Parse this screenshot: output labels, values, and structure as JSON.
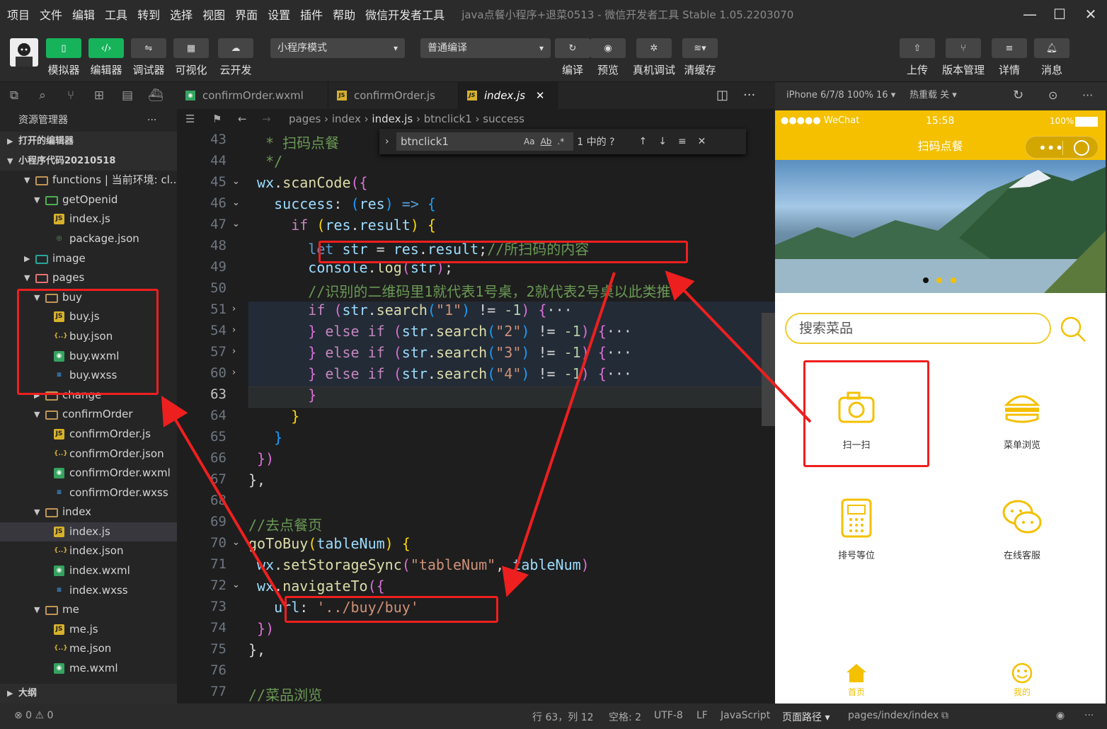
{
  "menu": [
    "项目",
    "文件",
    "编辑",
    "工具",
    "转到",
    "选择",
    "视图",
    "界面",
    "设置",
    "插件",
    "帮助",
    "微信开发者工具"
  ],
  "window_title": "java点餐小程序+退菜0513 - 微信开发者工具 Stable 1.05.2203070",
  "toolbar": {
    "simulator": "模拟器",
    "editor": "编辑器",
    "debugger": "调试器",
    "visual": "可视化",
    "cloud": "云开发",
    "mode": "小程序模式",
    "compile_mode": "普通编译",
    "compile": "编译",
    "preview": "预览",
    "real_debug": "真机调试",
    "clear_cache": "清缓存",
    "upload": "上传",
    "version": "版本管理",
    "details": "详情",
    "messages": "消息"
  },
  "explorer": {
    "title": "资源管理器",
    "more": "···",
    "open_editors": "打开的编辑器",
    "project": "小程序代码20210518",
    "outline": "大纲",
    "items": [
      {
        "label": "functions | 当前环境: cl...",
        "indent": 1,
        "type": "folder",
        "open": true
      },
      {
        "label": "getOpenid",
        "indent": 2,
        "type": "folder-green",
        "open": true
      },
      {
        "label": "index.js",
        "indent": 3,
        "type": "js"
      },
      {
        "label": "package.json",
        "indent": 3,
        "type": "pkg"
      },
      {
        "label": "image",
        "indent": 1,
        "type": "folder-img",
        "open": false
      },
      {
        "label": "pages",
        "indent": 1,
        "type": "folder-red",
        "open": true
      },
      {
        "label": "buy",
        "indent": 2,
        "type": "folder",
        "open": true
      },
      {
        "label": "buy.js",
        "indent": 3,
        "type": "js"
      },
      {
        "label": "buy.json",
        "indent": 3,
        "type": "json"
      },
      {
        "label": "buy.wxml",
        "indent": 3,
        "type": "wxml"
      },
      {
        "label": "buy.wxss",
        "indent": 3,
        "type": "wxss"
      },
      {
        "label": "change",
        "indent": 2,
        "type": "folder",
        "open": false
      },
      {
        "label": "confirmOrder",
        "indent": 2,
        "type": "folder",
        "open": true
      },
      {
        "label": "confirmOrder.js",
        "indent": 3,
        "type": "js"
      },
      {
        "label": "confirmOrder.json",
        "indent": 3,
        "type": "json"
      },
      {
        "label": "confirmOrder.wxml",
        "indent": 3,
        "type": "wxml"
      },
      {
        "label": "confirmOrder.wxss",
        "indent": 3,
        "type": "wxss"
      },
      {
        "label": "index",
        "indent": 2,
        "type": "folder",
        "open": true
      },
      {
        "label": "index.js",
        "indent": 3,
        "type": "js",
        "selected": true
      },
      {
        "label": "index.json",
        "indent": 3,
        "type": "json"
      },
      {
        "label": "index.wxml",
        "indent": 3,
        "type": "wxml"
      },
      {
        "label": "index.wxss",
        "indent": 3,
        "type": "wxss"
      },
      {
        "label": "me",
        "indent": 2,
        "type": "folder",
        "open": true
      },
      {
        "label": "me.js",
        "indent": 3,
        "type": "js"
      },
      {
        "label": "me.json",
        "indent": 3,
        "type": "json"
      },
      {
        "label": "me.wxml",
        "indent": 3,
        "type": "wxml"
      }
    ]
  },
  "tabs": [
    {
      "label": "confirmOrder.wxml",
      "icon": "wxml"
    },
    {
      "label": "confirmOrder.js",
      "icon": "js"
    },
    {
      "label": "index.js",
      "icon": "js",
      "active": true
    }
  ],
  "breadcrumb": [
    "pages",
    "index",
    "index.js",
    "btnclick1",
    "success"
  ],
  "find": {
    "query": "btnclick1",
    "result": "1 中的 ?"
  },
  "code": [
    {
      "n": "43",
      "html": "  <span class='c'>* 扫码点餐</span>"
    },
    {
      "n": "44",
      "html": "  <span class='c'>*/</span>"
    },
    {
      "n": "45",
      "html": " <span class='v'>wx</span>.<span class='f'>scanCode</span><span class='p'>({</span>",
      "fold": "v"
    },
    {
      "n": "46",
      "html": "   <span class='v'>success</span>: <span class='bl'>(</span><span class='v'>res</span><span class='bl'>)</span> <span class='b'>=&gt;</span> <span class='bl'>{</span>",
      "fold": "v"
    },
    {
      "n": "47",
      "html": "     <span class='k'>if</span> <span class='y'>(</span><span class='v'>res</span>.<span class='v'>result</span><span class='y'>)</span> <span class='y'>{</span>",
      "fold": "v"
    },
    {
      "n": "48",
      "html": "       <span class='b'>let</span> <span class='v'>str</span> = <span class='v'>res</span>.<span class='v'>result</span>;<span class='c'>//所扫码的内容</span>"
    },
    {
      "n": "49",
      "html": "       <span class='v'>console</span>.<span class='f'>log</span><span class='p'>(</span><span class='v'>str</span><span class='p'>)</span>;"
    },
    {
      "n": "50",
      "html": "       <span class='c'>//识别的二维码里1就代表1号桌，2就代表2号桌以此类推</span>"
    },
    {
      "n": "51",
      "html": "       <span class='k'>if</span> <span class='p'>(</span><span class='v'>str</span>.<span class='f'>search</span><span class='bl'>(</span><span class='s'>\"1\"</span><span class='bl'>)</span> != <span class='n'>-1</span><span class='p'>)</span> <span class='p'>{</span><span class='w'>···</span>",
      "fold": ">"
    },
    {
      "n": "54",
      "html": "       <span class='p'>}</span> <span class='k'>else if</span> <span class='p'>(</span><span class='v'>str</span>.<span class='f'>search</span><span class='bl'>(</span><span class='s'>\"2\"</span><span class='bl'>)</span> != <span class='n'>-1</span><span class='p'>)</span> <span class='p'>{</span><span class='w'>···</span>",
      "fold": ">"
    },
    {
      "n": "57",
      "html": "       <span class='p'>}</span> <span class='k'>else if</span> <span class='p'>(</span><span class='v'>str</span>.<span class='f'>search</span><span class='bl'>(</span><span class='s'>\"3\"</span><span class='bl'>)</span> != <span class='n'>-1</span><span class='p'>)</span> <span class='p'>{</span><span class='w'>···</span>",
      "fold": ">"
    },
    {
      "n": "60",
      "html": "       <span class='p'>}</span> <span class='k'>else if</span> <span class='p'>(</span><span class='v'>str</span>.<span class='f'>search</span><span class='bl'>(</span><span class='s'>\"4\"</span><span class='bl'>)</span> != <span class='n'>-1</span><span class='p'>)</span> <span class='p'>{</span><span class='w'>···</span>",
      "fold": ">"
    },
    {
      "n": "63",
      "html": "       <span class='p'>}</span>",
      "current": true
    },
    {
      "n": "64",
      "html": "     <span class='y'>}</span>"
    },
    {
      "n": "65",
      "html": "   <span class='bl'>}</span>"
    },
    {
      "n": "66",
      "html": " <span class='p'>})</span>"
    },
    {
      "n": "67",
      "html": "},"
    },
    {
      "n": "68",
      "html": ""
    },
    {
      "n": "69",
      "html": "<span class='c'>//去点餐页</span>"
    },
    {
      "n": "70",
      "html": "<span class='f'>goToBuy</span><span class='y'>(</span><span class='v'>tableNum</span><span class='y'>)</span> <span class='y'>{</span>",
      "fold": "v"
    },
    {
      "n": "71",
      "html": " <span class='v'>wx</span>.<span class='f'>setStorageSync</span><span class='p'>(</span><span class='s'>\"tableNum\"</span>, <span class='v'>tableNum</span><span class='p'>)</span>"
    },
    {
      "n": "72",
      "html": " <span class='v'>wx</span>.<span class='f'>navigateTo</span><span class='p'>({</span>",
      "fold": "v"
    },
    {
      "n": "73",
      "html": "   <span class='v'>url</span>: <span class='s'>'../buy/buy'</span>"
    },
    {
      "n": "74",
      "html": " <span class='p'>})</span>"
    },
    {
      "n": "75",
      "html": "},"
    },
    {
      "n": "76",
      "html": ""
    },
    {
      "n": "77",
      "html": "<span class='c'>//菜品浏览</span>"
    }
  ],
  "simulator": {
    "device": "iPhone 6/7/8 100% 16 ▾",
    "hot_reload": "热重载 关 ▾",
    "carrier": "●●●●● WeChat",
    "time": "15:58",
    "battery": "100%",
    "page_title": "扫码点餐",
    "search_placeholder": "搜索菜品",
    "grid": [
      {
        "label": "扫一扫",
        "icon": "camera-icon"
      },
      {
        "label": "菜单浏览",
        "icon": "burger-icon"
      },
      {
        "label": "排号等位",
        "icon": "phone-icon"
      },
      {
        "label": "在线客服",
        "icon": "chat-icon"
      }
    ],
    "tabbar": [
      {
        "label": "首页",
        "icon": "home-icon"
      },
      {
        "label": "我的",
        "icon": "smile-icon"
      }
    ]
  },
  "statusbar": {
    "problems": "⊗ 0 ⚠ 0",
    "position": "行 63，列 12",
    "spaces": "空格: 2",
    "encoding": "UTF-8",
    "eol": "LF",
    "language": "JavaScript",
    "page_path_label": "页面路径 ▾",
    "page_path": "pages/index/index"
  },
  "colors": {
    "accent": "#f4c000",
    "toolbar_green": "#17b35b",
    "annotation_red": "#ee1f1f"
  }
}
